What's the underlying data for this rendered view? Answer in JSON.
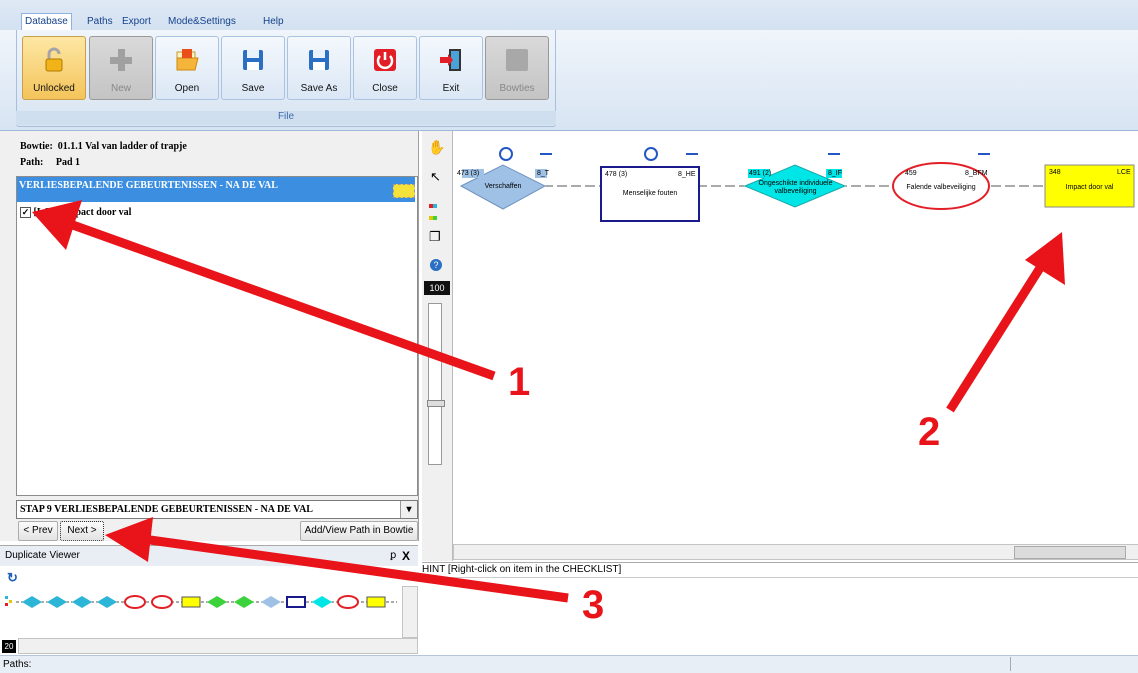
{
  "ribbon": {
    "tabs": [
      "Database",
      "Paths",
      "Export",
      "Mode&Settings",
      "Help"
    ],
    "buttons": [
      "Unlocked",
      "New",
      "Open",
      "Save",
      "Save As",
      "Close",
      "Exit",
      "Bowties"
    ],
    "group_label": "File"
  },
  "left": {
    "bowtie_label": "Bowtie:",
    "bowtie_value": "01.1.1 Val van ladder of trapje",
    "path_label": "Path:",
    "path_value": "Pad 1",
    "list_header": "VERLIESBEPALENDE GEBEURTENISSEN - NA DE VAL",
    "items": [
      {
        "label": "[LCE] Impact door val",
        "checked": true
      }
    ],
    "step_select": "STAP 9 VERLIESBEPALENDE GEBEURTENISSEN - NA DE VAL",
    "prev_label": "< Prev",
    "next_label": "Next >",
    "add_view_label": "Add/View Path in Bowtie"
  },
  "dup_viewer": {
    "title": "Duplicate Viewer",
    "pin": "2",
    "close": "X",
    "zoom": "20"
  },
  "toolstrip": {
    "zoom": "100"
  },
  "canvas": {
    "nodes": [
      {
        "id": "473 (3)",
        "code": "8_T",
        "label": "Verschaffen",
        "shape": "diamond",
        "color": "#9fc1e6"
      },
      {
        "id": "478 (3)",
        "code": "8_HE",
        "label": "Menselijke fouten",
        "shape": "rect",
        "color": "#ffffff"
      },
      {
        "id": "491 (2)",
        "code": "8_IF",
        "label": "Ongeschikte individuele valbeveiliging",
        "shape": "diamond",
        "color": "#00e5e5"
      },
      {
        "id": "459",
        "code": "8_BFM",
        "label": "Falende valbeveiliging",
        "shape": "ellipse",
        "color": "#ffffff"
      },
      {
        "id": "348",
        "code": "LCE",
        "label": "Impact door val",
        "shape": "rect",
        "color": "#ffff00"
      }
    ]
  },
  "annotations": [
    "1",
    "2",
    "3"
  ],
  "hint": "HINT [Right-click on item in the CHECKLIST]",
  "status": {
    "paths_label": "Paths:"
  },
  "colors": {
    "accent": "#3c8fe0",
    "arrow": "#e8141a"
  }
}
